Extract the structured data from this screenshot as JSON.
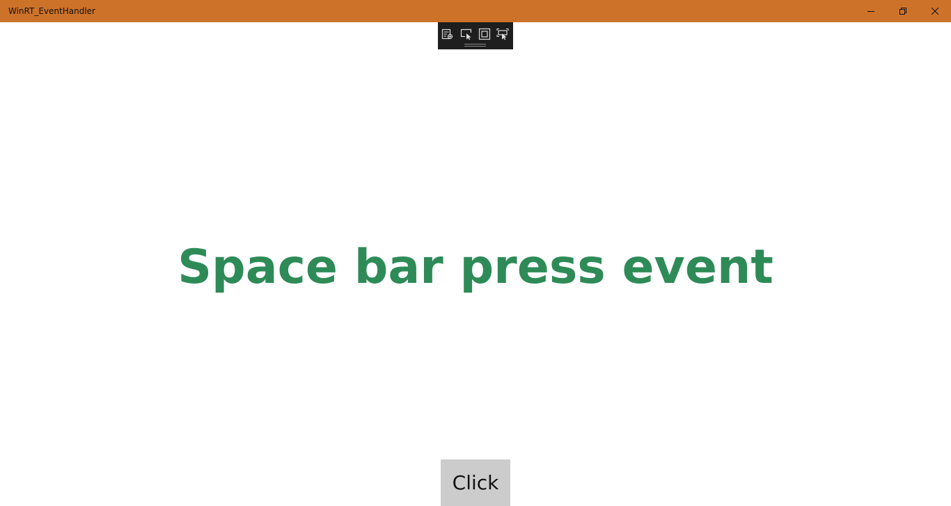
{
  "window": {
    "title": "WinRT_EventHandler",
    "titlebar_color": "#cd7229",
    "controls": {
      "minimize_icon": "minimize-icon",
      "restore_icon": "restore-icon",
      "close_icon": "close-icon"
    }
  },
  "dev_toolbar": {
    "tools": [
      {
        "icon": "live-visual-tree-icon"
      },
      {
        "icon": "select-element-icon"
      },
      {
        "icon": "display-layout-adorners-icon"
      },
      {
        "icon": "track-focus-icon"
      }
    ]
  },
  "main": {
    "headline": "Space bar press event",
    "headline_color": "#2e8b57",
    "button_label": "Click",
    "button_color": "#cccccc"
  }
}
